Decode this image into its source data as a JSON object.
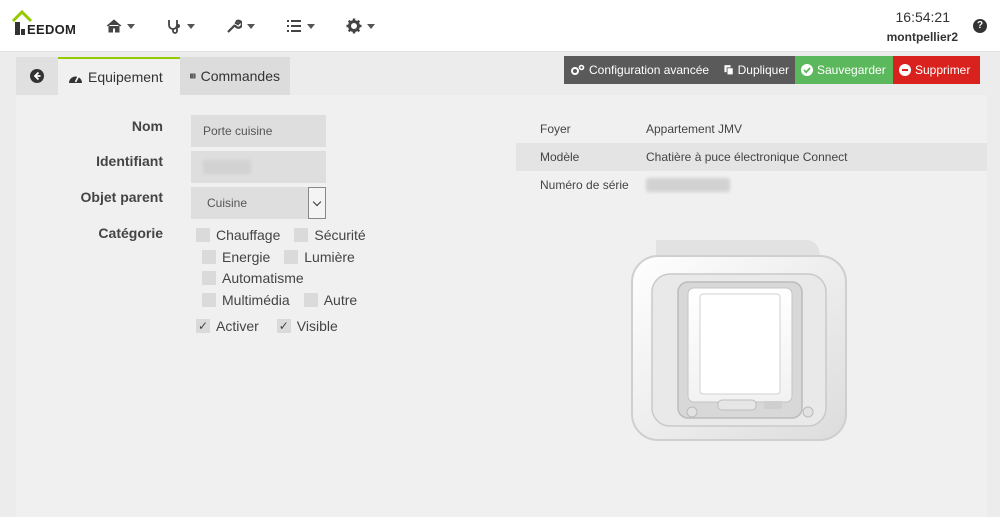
{
  "brand": {
    "logo_text": "EEDOM"
  },
  "nav": {
    "items": [
      {
        "name": "home-icon"
      },
      {
        "name": "stethoscope-icon"
      },
      {
        "name": "wrench-icon"
      },
      {
        "name": "list-icon"
      },
      {
        "name": "gear-icon"
      }
    ],
    "time": "16:54:21",
    "user": "montpellier2",
    "help": "?"
  },
  "tabs": {
    "equipment": "Equipement",
    "commands": "Commandes"
  },
  "actions": {
    "advanced_config": "Configuration avancée",
    "duplicate": "Dupliquer",
    "save": "Sauvegarder",
    "delete": "Supprimer"
  },
  "form": {
    "name_label": "Nom",
    "name_value": "Porte cuisine",
    "id_label": "Identifiant",
    "parent_label": "Objet parent",
    "parent_value": "Cuisine",
    "category_label": "Catégorie",
    "categories": {
      "heating": "Chauffage",
      "security": "Sécurité",
      "energy": "Energie",
      "light": "Lumière",
      "automation": "Automatisme",
      "multimedia": "Multimédia",
      "other": "Autre"
    },
    "enable_label": "Activer",
    "enable_checked": true,
    "visible_label": "Visible",
    "visible_checked": true
  },
  "info": {
    "home_key": "Foyer",
    "home_value": "Appartement JMV",
    "model_key": "Modèle",
    "model_value": "Chatière à puce électronique Connect",
    "serial_key": "Numéro de série"
  },
  "colors": {
    "accent": "#94ca02",
    "save": "#5cb85c",
    "delete": "#d9221d",
    "dark_button": "#5a5a5a"
  }
}
